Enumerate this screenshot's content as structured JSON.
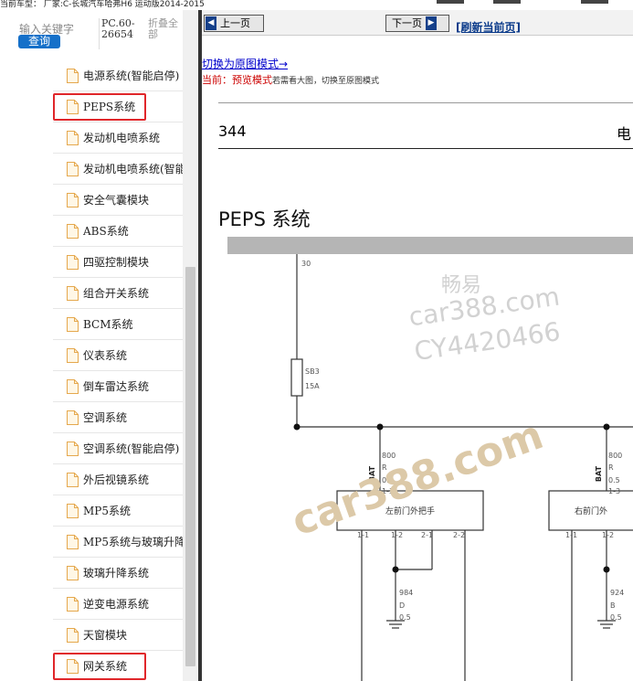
{
  "top_bar": {
    "breadcrumb": "当前车型： 厂家:C-长城汽车哈弗H6 运动版2014-2015"
  },
  "left_panel": {
    "search_placeholder": "输入关键字",
    "search_button": "查询",
    "doc_code": "PC.60-26654",
    "collapse_all": "折叠全部",
    "tree_items": [
      {
        "label": "电源系统(智能启停)"
      },
      {
        "label": "PEPS系统"
      },
      {
        "label": "发动机电喷系统"
      },
      {
        "label": "发动机电喷系统(智能启停)"
      },
      {
        "label": "安全气囊模块"
      },
      {
        "label": "ABS系统"
      },
      {
        "label": "四驱控制模块"
      },
      {
        "label": "组合开关系统"
      },
      {
        "label": "BCM系统"
      },
      {
        "label": "仪表系统"
      },
      {
        "label": "倒车雷达系统"
      },
      {
        "label": "空调系统"
      },
      {
        "label": "空调系统(智能启停)"
      },
      {
        "label": "外后视镜系统"
      },
      {
        "label": "MP5系统"
      },
      {
        "label": "MP5系统与玻璃升降"
      },
      {
        "label": "玻璃升降系统"
      },
      {
        "label": "逆变电源系统"
      },
      {
        "label": "天窗模块"
      },
      {
        "label": "网关系统"
      }
    ],
    "highlighted": [
      "PEPS系统",
      "网关系统"
    ]
  },
  "viewer": {
    "prev_button": "上一页",
    "next_button": "下一页",
    "refresh_link": "[刷新当前页]",
    "switch_link": "切换为原图模式→",
    "mode_label": "当前：",
    "mode_value": "预览模式",
    "mode_hint": "若需看大图，切换至原图模式",
    "page_number": "344",
    "page_category": "电",
    "page_title": "PEPS 系统"
  },
  "diagram": {
    "label_30": "30",
    "fuse_name": "SB3",
    "fuse_rating": "15A",
    "left_wire": {
      "id": "800",
      "color": "R",
      "size": "0.5",
      "pin": "1-3",
      "tag": "BAT"
    },
    "right_wire": {
      "id": "800",
      "color": "R",
      "size": "0.5",
      "pin": "1-3",
      "tag": "BAT"
    },
    "left_module": "左前门外把手",
    "right_module": "右前门外",
    "left_pins": [
      "1-1",
      "1-2",
      "2-1",
      "2-2"
    ],
    "right_pins": [
      "1-1",
      "1-2"
    ],
    "left_ground": {
      "id": "984",
      "color": "D",
      "size": "0.5"
    },
    "right_ground": {
      "id": "924",
      "color": "B",
      "size": "0.5"
    }
  },
  "watermarks": {
    "line1": "畅易",
    "line2": "car388.com",
    "line3": "CY4420466",
    "diag_text": "car388.com"
  }
}
